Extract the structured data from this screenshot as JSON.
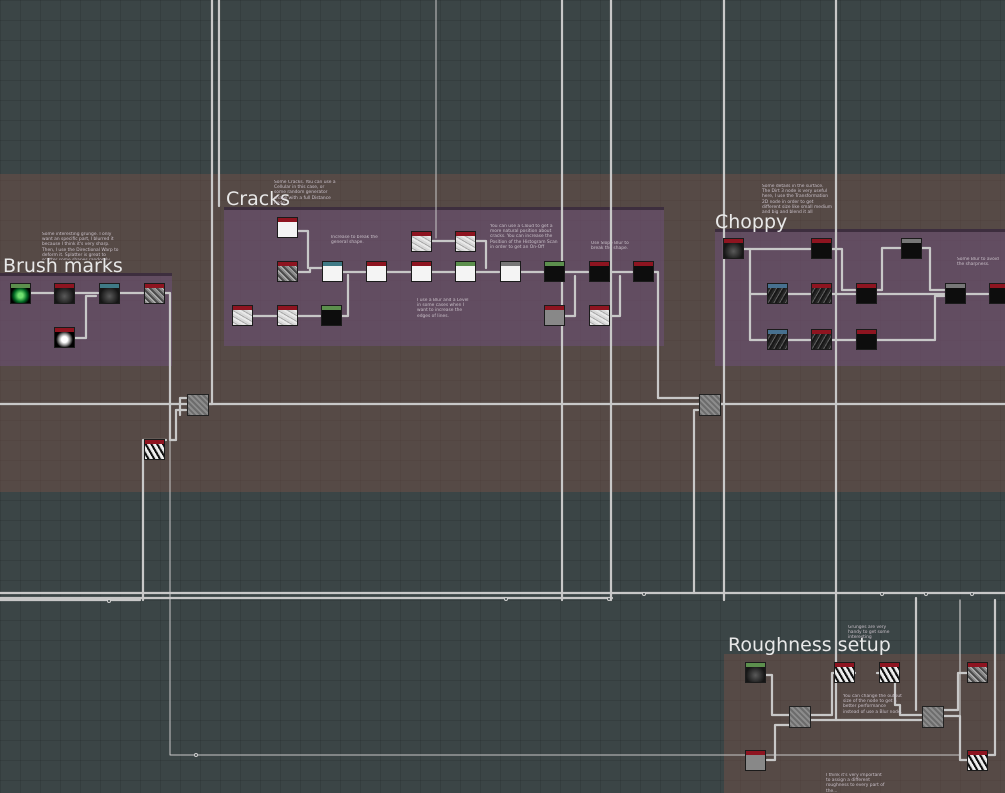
{
  "frames": {
    "brush_marks": {
      "title": "Brush marks",
      "comment": "Some interesting grunge. I only want an specific part, I blurred it because I think it's very sharp. Then, I use the Directional Warp to deform it. Splatter is great to scatter some shapes randomly."
    },
    "cracks": {
      "title": "Cracks",
      "comment_main": "Some Cracks. You can use a Cellular in this case, or some random generator shape with a full Distance node.",
      "comment_shape": "Increase to break the general shape.",
      "comment_cloud": "You can use a Cloud to get a more natural position about cracks. You can increase the Position of the Histogram Scan in order to get an On-Off parameter.",
      "comment_slope": "Use Slope Blur to break the shape.",
      "comment_levels": "I use a Blur and a Level in some cases when I want to increase the edges of lines."
    },
    "choppy": {
      "title": "Choppy",
      "comment_main": "Some details in the surface. The Dirt 3 node is very useful here, I use the Transformation 2D node in order to get different size like small medium and big and blend it all together.",
      "comment_right": "Some Blur to avoid the sharpness."
    },
    "roughness": {
      "title": "Roughness setup",
      "comment_grunge": "Grunges are very handy to get some interesting roughness.",
      "comment_blend": "You can change the output size of the node to get a better performance instead of use a Blur node.",
      "comment_bottom": "I think it's very important to assign a different roughness to every part of the..."
    }
  },
  "colors": {
    "background": "#3b4546",
    "band": "#7a5046",
    "frame": "#6e5078",
    "wire": "#c8c8c8",
    "header_red": "#8e1420",
    "header_green": "#5c8f4d",
    "header_blue": "#47708f"
  },
  "nodes": [
    {
      "id": "bm-1",
      "kind": "grunge-node",
      "header": "green",
      "thumb": "green"
    },
    {
      "id": "bm-2",
      "kind": "blur-node",
      "header": "red",
      "thumb": "dark"
    },
    {
      "id": "bm-3",
      "kind": "directional-warp-node",
      "header": "teal",
      "thumb": "dark"
    },
    {
      "id": "bm-4",
      "kind": "splatter-node",
      "header": "red",
      "thumb": "speck"
    },
    {
      "id": "bm-5",
      "kind": "shape-node",
      "header": "red",
      "thumb": "glow"
    },
    {
      "id": "cr-1",
      "kind": "cellular-node",
      "header": "red",
      "thumb": "white"
    },
    {
      "id": "cr-2",
      "kind": "noise-node",
      "header": "red",
      "thumb": "speck"
    },
    {
      "id": "cr-3",
      "kind": "distance-node",
      "header": "teal",
      "thumb": "white"
    },
    {
      "id": "cr-4",
      "kind": "levels-node",
      "header": "red",
      "thumb": "white"
    },
    {
      "id": "cr-5",
      "kind": "warp-node",
      "header": "red",
      "thumb": "white"
    },
    {
      "id": "cr-6",
      "kind": "blend-node",
      "header": "green",
      "thumb": "white"
    },
    {
      "id": "cr-7",
      "kind": "blend-node",
      "header": "gray",
      "thumb": "white"
    },
    {
      "id": "cr-8",
      "kind": "histogram-scan-node",
      "header": "green",
      "thumb": "black"
    },
    {
      "id": "cr-9",
      "kind": "slope-blur-node",
      "header": "red",
      "thumb": "black"
    },
    {
      "id": "cr-10",
      "kind": "levels-node",
      "header": "red",
      "thumb": "black"
    },
    {
      "id": "cr-11",
      "kind": "cloud-node",
      "header": "red",
      "thumb": "light"
    },
    {
      "id": "cr-12",
      "kind": "cloud-node",
      "header": "red",
      "thumb": "light"
    },
    {
      "id": "cr-13",
      "kind": "cloud-node",
      "header": "red",
      "thumb": "light"
    },
    {
      "id": "cr-14",
      "kind": "blur-node",
      "header": "red",
      "thumb": "light"
    },
    {
      "id": "cr-15",
      "kind": "levels-node",
      "header": "green",
      "thumb": "black"
    },
    {
      "id": "cr-16",
      "kind": "uniform-color-node",
      "header": "red",
      "thumb": "gray"
    },
    {
      "id": "cr-17",
      "kind": "grunge-node",
      "header": "red",
      "thumb": "light"
    },
    {
      "id": "ch-1",
      "kind": "dirt-node",
      "header": "red",
      "thumb": "dark"
    },
    {
      "id": "ch-2",
      "kind": "transform-2d-node",
      "header": "red",
      "thumb": "black"
    },
    {
      "id": "ch-3",
      "kind": "transform-2d-node",
      "header": "blue",
      "thumb": "grunge"
    },
    {
      "id": "ch-4",
      "kind": "transform-2d-node",
      "header": "blue",
      "thumb": "grunge"
    },
    {
      "id": "ch-5",
      "kind": "levels-node",
      "header": "red",
      "thumb": "grunge"
    },
    {
      "id": "ch-6",
      "kind": "levels-node",
      "header": "red",
      "thumb": "grunge"
    },
    {
      "id": "ch-7",
      "kind": "blend-node",
      "header": "red",
      "thumb": "black"
    },
    {
      "id": "ch-8",
      "kind": "blend-node",
      "header": "red",
      "thumb": "black"
    },
    {
      "id": "ch-9",
      "kind": "blend-node",
      "header": "gray",
      "thumb": "black"
    },
    {
      "id": "ch-10",
      "kind": "blur-node",
      "header": "gray",
      "thumb": "black"
    },
    {
      "id": "ch-11",
      "kind": "output-node",
      "header": "red",
      "thumb": "black"
    },
    {
      "id": "mid-1",
      "kind": "blend-node",
      "header": "none",
      "thumb": "blend"
    },
    {
      "id": "mid-2",
      "kind": "blend-node",
      "header": "none",
      "thumb": "blend"
    },
    {
      "id": "mid-3",
      "kind": "mask-node",
      "header": "red",
      "thumb": "bw"
    },
    {
      "id": "rs-1",
      "kind": "grunge-node",
      "header": "green",
      "thumb": "dark"
    },
    {
      "id": "rs-2",
      "kind": "grunge-node",
      "header": "red",
      "thumb": "bw"
    },
    {
      "id": "rs-3",
      "kind": "grunge-node",
      "header": "red",
      "thumb": "bw"
    },
    {
      "id": "rs-4",
      "kind": "blend-node",
      "header": "none",
      "thumb": "blend"
    },
    {
      "id": "rs-5",
      "kind": "blend-node",
      "header": "none",
      "thumb": "blend"
    },
    {
      "id": "rs-6",
      "kind": "uniform-color-node",
      "header": "red",
      "thumb": "gray"
    },
    {
      "id": "rs-7",
      "kind": "grunge-node",
      "header": "red",
      "thumb": "speck"
    },
    {
      "id": "rs-8",
      "kind": "mask-node",
      "header": "red",
      "thumb": "bw"
    }
  ]
}
